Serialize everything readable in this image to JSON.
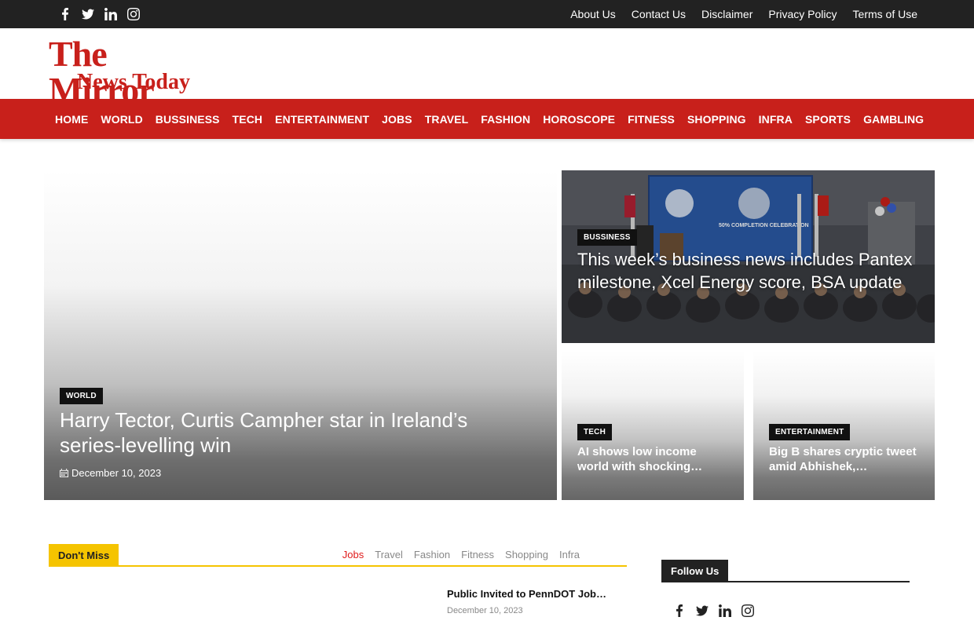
{
  "topbar": {
    "social": [
      {
        "name": "facebook-icon"
      },
      {
        "name": "twitter-icon"
      },
      {
        "name": "linkedin-icon"
      },
      {
        "name": "instagram-icon"
      }
    ],
    "links": [
      "About Us",
      "Contact Us",
      "Disclaimer",
      "Privacy Policy",
      "Terms of Use"
    ]
  },
  "logo": {
    "line1": "The Mirror",
    "line2": "News Today",
    "color": "#c8201b"
  },
  "nav": {
    "color": "#c8201b",
    "items": [
      "HOME",
      "WORLD",
      "BUSSINESS",
      "TECH",
      "ENTERTAINMENT",
      "JOBS",
      "TRAVEL",
      "FASHION",
      "HOROSCOPE",
      "FITNESS",
      "SHOPPING",
      "INFRA",
      "SPORTS",
      "GAMBLING"
    ]
  },
  "hero": {
    "main": {
      "category": "WORLD",
      "title": "Harry Tector, Curtis Campher star in Ireland’s series-levelling win",
      "date": "December 10, 2023"
    },
    "top": {
      "category": "BUSSINESS",
      "title": "This week’s business news includes Pantex milestone, Xcel Energy score, BSA update",
      "screen_text": "50% COMPLETION CELEBRATION"
    },
    "small": [
      {
        "category": "TECH",
        "title": "AI shows low income world with shocking…"
      },
      {
        "category": "ENTERTAINMENT",
        "title": "Big B shares cryptic tweet amid Abhishek,…"
      }
    ]
  },
  "dont_miss": {
    "label": "Don't Miss",
    "accent": "#f5c400",
    "tabs": [
      "Jobs",
      "Travel",
      "Fashion",
      "Fitness",
      "Shopping",
      "Infra"
    ],
    "active_tab": "Jobs",
    "item": {
      "title": "Public Invited to PennDOT Job…",
      "date": "December 10, 2023"
    }
  },
  "follow_us": {
    "label": "Follow Us",
    "social": [
      {
        "name": "facebook-icon"
      },
      {
        "name": "twitter-icon"
      },
      {
        "name": "linkedin-icon"
      },
      {
        "name": "instagram-icon"
      }
    ]
  }
}
